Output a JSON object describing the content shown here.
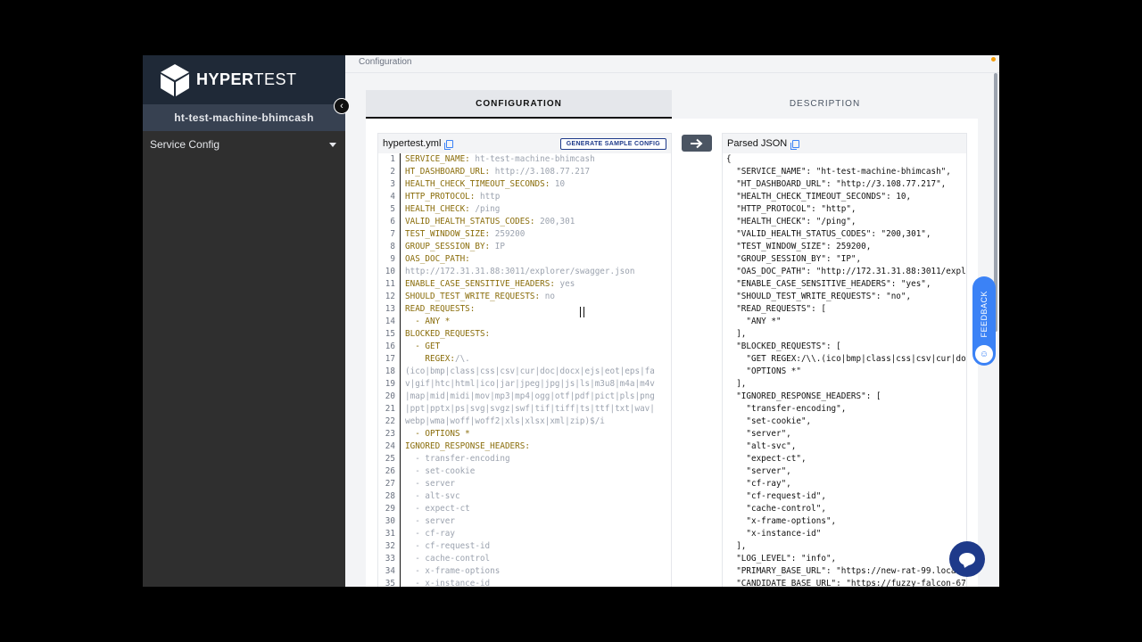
{
  "brand": {
    "name_bold": "HYPER",
    "name_light": "TEST"
  },
  "sidebar": {
    "machine_name": "ht-test-machine-bhimcash",
    "collapse_icon": "chevron-left-icon",
    "items": [
      {
        "label": "Service Config",
        "icon": "caret-down-icon"
      }
    ]
  },
  "topbar": {
    "breadcrumb": "Configuration"
  },
  "tabs": [
    {
      "label": "CONFIGURATION",
      "active": true
    },
    {
      "label": "DESCRIPTION",
      "active": false
    }
  ],
  "yaml_panel": {
    "title": "hypertest.yml",
    "generate_label": "GENERATE SAMPLE CONFIG",
    "lines": [
      {
        "n": "1",
        "k": "SERVICE_NAME:",
        "v": " ht-test-machine-bhimcash"
      },
      {
        "n": "2",
        "k": "HT_DASHBOARD_URL:",
        "v": " http://3.108.77.217"
      },
      {
        "n": "3",
        "k": "HEALTH_CHECK_TIMEOUT_SECONDS:",
        "v": " 10"
      },
      {
        "n": "4",
        "k": "HTTP_PROTOCOL:",
        "v": " http"
      },
      {
        "n": "5",
        "k": "HEALTH_CHECK:",
        "v": " /ping"
      },
      {
        "n": "6",
        "k": "VALID_HEALTH_STATUS_CODES:",
        "v": " 200,301"
      },
      {
        "n": "7",
        "k": "TEST_WINDOW_SIZE:",
        "v": " 259200"
      },
      {
        "n": "8",
        "k": "GROUP_SESSION_BY:",
        "v": " IP"
      },
      {
        "n": "9",
        "k": "OAS_DOC_PATH:",
        "v": ""
      },
      {
        "n": "10",
        "k": "",
        "v": "http://172.31.31.88:3011/explorer/swagger.json"
      },
      {
        "n": "11",
        "k": "ENABLE_CASE_SENSITIVE_HEADERS:",
        "v": " yes"
      },
      {
        "n": "12",
        "k": "SHOULD_TEST_WRITE_REQUESTS:",
        "v": " no"
      },
      {
        "n": "13",
        "k": "READ_REQUESTS:",
        "v": ""
      },
      {
        "n": "14",
        "k": "  - ANY *",
        "v": ""
      },
      {
        "n": "15",
        "k": "BLOCKED_REQUESTS:",
        "v": ""
      },
      {
        "n": "16",
        "k": "  - GET",
        "v": ""
      },
      {
        "n": "17",
        "k": "    REGEX:",
        "v": "/\\."
      },
      {
        "n": "18",
        "k": "",
        "v": "(ico|bmp|class|css|csv|cur|doc|docx|ejs|eot|eps|fa"
      },
      {
        "n": "19",
        "k": "",
        "v": "v|gif|htc|html|ico|jar|jpeg|jpg|js|ls|m3u8|m4a|m4v"
      },
      {
        "n": "20",
        "k": "",
        "v": "|map|mid|midi|mov|mp3|mp4|ogg|otf|pdf|pict|pls|png"
      },
      {
        "n": "21",
        "k": "",
        "v": "|ppt|pptx|ps|svg|svgz|swf|tif|tiff|ts|ttf|txt|wav|"
      },
      {
        "n": "22",
        "k": "",
        "v": "webp|wma|woff|woff2|xls|xlsx|xml|zip)$/i"
      },
      {
        "n": "23",
        "k": "  - OPTIONS *",
        "v": ""
      },
      {
        "n": "24",
        "k": "IGNORED_RESPONSE_HEADERS:",
        "v": ""
      },
      {
        "n": "25",
        "k": "",
        "v": "  - transfer-encoding"
      },
      {
        "n": "26",
        "k": "",
        "v": "  - set-cookie"
      },
      {
        "n": "27",
        "k": "",
        "v": "  - server"
      },
      {
        "n": "28",
        "k": "",
        "v": "  - alt-svc"
      },
      {
        "n": "29",
        "k": "",
        "v": "  - expect-ct"
      },
      {
        "n": "30",
        "k": "",
        "v": "  - server"
      },
      {
        "n": "31",
        "k": "",
        "v": "  - cf-ray"
      },
      {
        "n": "32",
        "k": "",
        "v": "  - cf-request-id"
      },
      {
        "n": "33",
        "k": "",
        "v": "  - cache-control"
      },
      {
        "n": "34",
        "k": "",
        "v": "  - x-frame-options"
      },
      {
        "n": "35",
        "k": "",
        "v": "  - x-instance-id"
      }
    ]
  },
  "json_panel": {
    "title": "Parsed JSON",
    "lines": [
      "{",
      "  \"SERVICE_NAME\": \"ht-test-machine-bhimcash\",",
      "  \"HT_DASHBOARD_URL\": \"http://3.108.77.217\",",
      "  \"HEALTH_CHECK_TIMEOUT_SECONDS\": 10,",
      "  \"HTTP_PROTOCOL\": \"http\",",
      "  \"HEALTH_CHECK\": \"/ping\",",
      "  \"VALID_HEALTH_STATUS_CODES\": \"200,301\",",
      "  \"TEST_WINDOW_SIZE\": 259200,",
      "  \"GROUP_SESSION_BY\": \"IP\",",
      "  \"OAS_DOC_PATH\": \"http://172.31.31.88:3011/expl",
      "  \"ENABLE_CASE_SENSITIVE_HEADERS\": \"yes\",",
      "  \"SHOULD_TEST_WRITE_REQUESTS\": \"no\",",
      "  \"READ_REQUESTS\": [",
      "    \"ANY *\"",
      "  ],",
      "  \"BLOCKED_REQUESTS\": [",
      "    \"GET REGEX:/\\\\.(ico|bmp|class|css|csv|cur|do",
      "    \"OPTIONS *\"",
      "  ],",
      "  \"IGNORED_RESPONSE_HEADERS\": [",
      "    \"transfer-encoding\",",
      "    \"set-cookie\",",
      "    \"server\",",
      "    \"alt-svc\",",
      "    \"expect-ct\",",
      "    \"server\",",
      "    \"cf-ray\",",
      "    \"cf-request-id\",",
      "    \"cache-control\",",
      "    \"x-frame-options\",",
      "    \"x-instance-id\"",
      "  ],",
      "  \"LOG_LEVEL\": \"info\",",
      "  \"PRIMARY_BASE_URL\": \"https://new-rat-99.loca",
      "  \"CANDIDATE_BASE_URL\": \"https://fuzzy-falcon-67"
    ]
  },
  "feedback": {
    "label": "FEEDBACK",
    "icon": "smile-icon"
  },
  "chat": {
    "icon": "chat-icon"
  },
  "colors": {
    "accent": "#3b82f6",
    "sidebar": "#2f2f2f",
    "yaml_key": "#8a6d0b",
    "chat": "#1e3a8a"
  }
}
